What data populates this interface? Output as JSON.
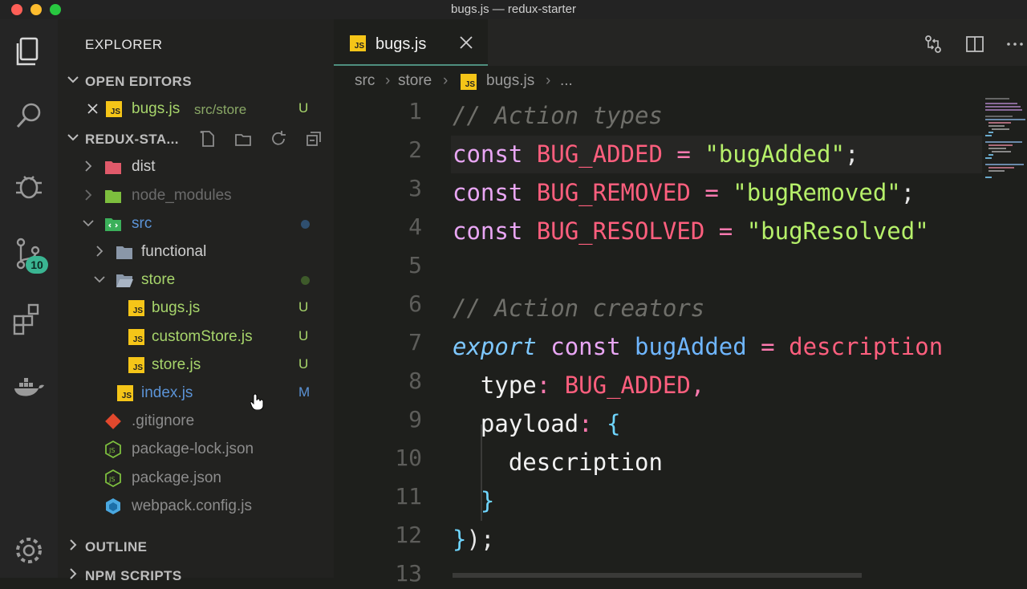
{
  "window": {
    "title": "bugs.js — redux-starter"
  },
  "activity_bar": {
    "scm_badge": "10"
  },
  "sidebar": {
    "title": "EXPLORER",
    "open_editors": {
      "label": "OPEN EDITORS",
      "items": [
        {
          "name": "bugs.js",
          "path": "src/store",
          "status": "U"
        }
      ]
    },
    "project": {
      "label": "REDUX-STA..."
    },
    "tree": [
      {
        "name": "dist"
      },
      {
        "name": "node_modules"
      },
      {
        "name": "src"
      },
      {
        "name": "functional"
      },
      {
        "name": "store"
      },
      {
        "name": "bugs.js",
        "status": "U"
      },
      {
        "name": "customStore.js",
        "status": "U"
      },
      {
        "name": "store.js",
        "status": "U"
      },
      {
        "name": "index.js",
        "status": "M"
      },
      {
        "name": ".gitignore"
      },
      {
        "name": "package-lock.json"
      },
      {
        "name": "package.json"
      },
      {
        "name": "webpack.config.js"
      }
    ],
    "outline": {
      "label": "OUTLINE"
    },
    "npm_scripts": {
      "label": "NPM SCRIPTS"
    }
  },
  "editor": {
    "tab": {
      "label": "bugs.js"
    },
    "breadcrumb": [
      "src",
      "store",
      "bugs.js",
      "..."
    ],
    "line_numbers": [
      "1",
      "2",
      "3",
      "4",
      "5",
      "6",
      "7",
      "8",
      "9",
      "10",
      "11",
      "12",
      "13"
    ],
    "lines": [
      [
        "// Action types"
      ],
      [
        "const",
        "BUG_ADDED",
        "=",
        "\"bugAdded\"",
        ";"
      ],
      [
        "const",
        "BUG_REMOVED",
        "=",
        "\"bugRemoved\"",
        ";"
      ],
      [
        "const",
        "BUG_RESOLVED",
        "=",
        "\"bugResolved\""
      ],
      [],
      [
        "// Action creators"
      ],
      [
        "export",
        "const",
        "bugAdded",
        "=",
        "description"
      ],
      [
        "type",
        ":",
        "BUG_ADDED",
        ","
      ],
      [
        "payload",
        ":",
        "{"
      ],
      [
        "description"
      ],
      [
        "}"
      ],
      [
        "}",
        ")",
        ";"
      ],
      []
    ]
  },
  "colors": {
    "accent": "#3ab592",
    "js_icon": "#f5c518",
    "untracked": "#a7d56b",
    "modified": "#5b93d6"
  }
}
